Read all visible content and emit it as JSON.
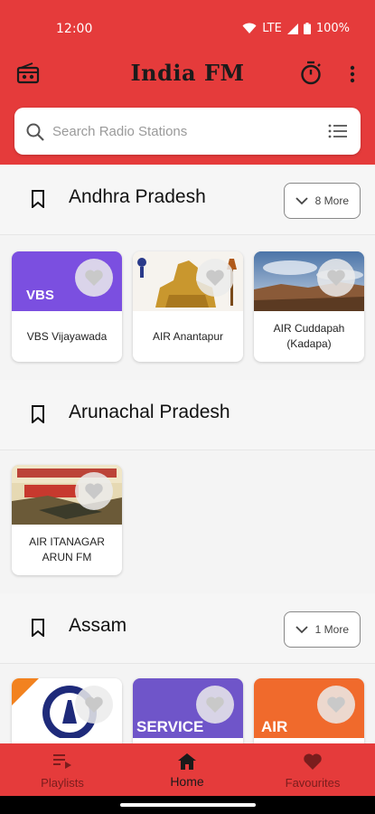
{
  "status": {
    "time": "12:00",
    "network": "LTE",
    "battery": "100%"
  },
  "app": {
    "title": "India FM"
  },
  "search": {
    "placeholder": "Search Radio Stations"
  },
  "sections": [
    {
      "name": "Andhra Pradesh",
      "more": "8 More",
      "stations": [
        {
          "name": "VBS Vijayawada",
          "thumb_text": "VBS",
          "thumb_color": "#7b4fe0"
        },
        {
          "name": "AIR Anantapur",
          "thumb_color": "#f3f0ea"
        },
        {
          "name": "AIR Cuddapah (Kadapa)",
          "thumb_color": "#5f87b8"
        }
      ]
    },
    {
      "name": "Arunachal Pradesh",
      "stations": [
        {
          "name": "AIR ITANAGAR ARUN FM",
          "thumb_color": "#d8c79a"
        }
      ]
    },
    {
      "name": "Assam",
      "more": "1 More",
      "stations": [
        {
          "name": "",
          "thumb_color": "#ffffff"
        },
        {
          "name": "",
          "thumb_text": "SERVICE",
          "thumb_color": "#6f55c9"
        },
        {
          "name": "",
          "thumb_text": "AIR",
          "thumb_color": "#f06a2c"
        }
      ]
    }
  ],
  "nav": {
    "playlists": "Playlists",
    "home": "Home",
    "favourites": "Favourites"
  },
  "colors": {
    "primary": "#e53b3b",
    "nav_inactive": "#7a1d1d"
  }
}
